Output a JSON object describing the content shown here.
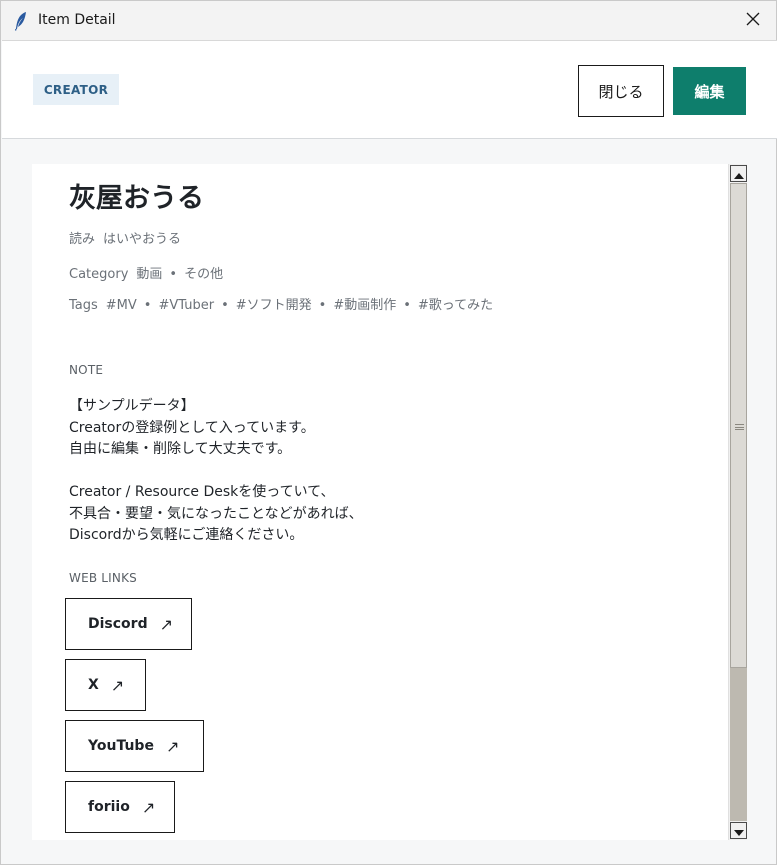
{
  "window": {
    "title": "Item Detail",
    "app_icon": "feather-icon",
    "close_icon": "close-icon"
  },
  "header": {
    "badge": "CREATOR",
    "close_button": "閉じる",
    "edit_button": "編集"
  },
  "item": {
    "name": "灰屋おうる",
    "reading_label": "読み",
    "reading": "はいやおうる",
    "category_label": "Category",
    "categories": [
      "動画",
      "その他"
    ],
    "tags_label": "Tags",
    "tags": [
      "#MV",
      "#VTuber",
      "#ソフト開発",
      "#動画制作",
      "#歌ってみた"
    ]
  },
  "note": {
    "label": "NOTE",
    "lines": [
      "【サンプルデータ】",
      "Creatorの登録例として入っています。",
      "自由に編集・削除して大丈夫です。",
      "",
      "Creator / Resource Deskを使っていて、",
      "不具合・要望・気になったことなどがあれば、",
      "Discordから気軽にご連絡ください。"
    ]
  },
  "web_links": {
    "label": "WEB LINKS",
    "arrow": "↗",
    "items": [
      "Discord",
      "X",
      "YouTube",
      "foriio"
    ]
  },
  "colors": {
    "accent": "#0e7e6c",
    "badge_bg": "#e7f0f7",
    "badge_text": "#2d5f86"
  },
  "scrollbar": {
    "thumb_fraction": 0.76,
    "position_fraction": 0.0
  }
}
